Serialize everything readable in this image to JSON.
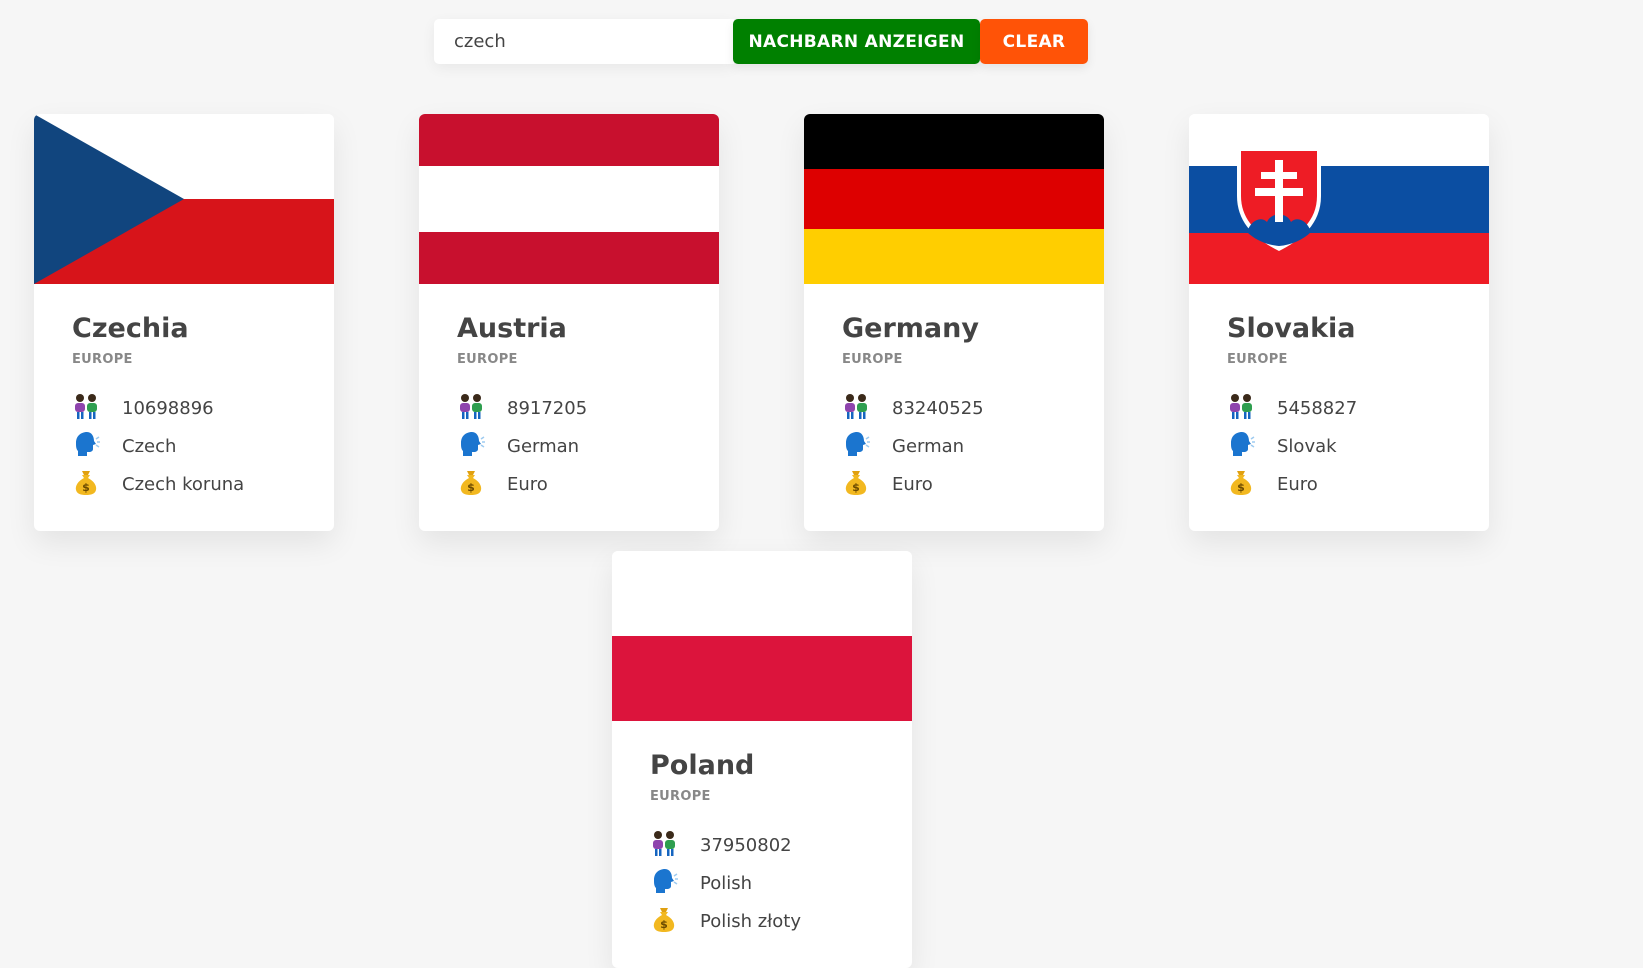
{
  "search": {
    "value": "czech",
    "show_neighbours_label": "NACHBARN ANZEIGEN",
    "clear_label": "CLEAR"
  },
  "colors": {
    "neighbours_button": "#008000",
    "clear_button": "#ff5307"
  },
  "countries": [
    {
      "name": "Czechia",
      "region": "EUROPE",
      "population": "10698896",
      "language": "Czech",
      "currency": "Czech koruna",
      "flag": "czechia-flag"
    },
    {
      "name": "Austria",
      "region": "EUROPE",
      "population": "8917205",
      "language": "German",
      "currency": "Euro",
      "flag": "austria-flag"
    },
    {
      "name": "Germany",
      "region": "EUROPE",
      "population": "83240525",
      "language": "German",
      "currency": "Euro",
      "flag": "germany-flag"
    },
    {
      "name": "Slovakia",
      "region": "EUROPE",
      "population": "5458827",
      "language": "Slovak",
      "currency": "Euro",
      "flag": "slovakia-flag"
    },
    {
      "name": "Poland",
      "region": "EUROPE",
      "population": "37950802",
      "language": "Polish",
      "currency": "Polish złoty",
      "flag": "poland-flag"
    }
  ],
  "icons": {
    "population": "people-icon",
    "language": "speaking-head-icon",
    "currency": "money-bag-icon"
  }
}
